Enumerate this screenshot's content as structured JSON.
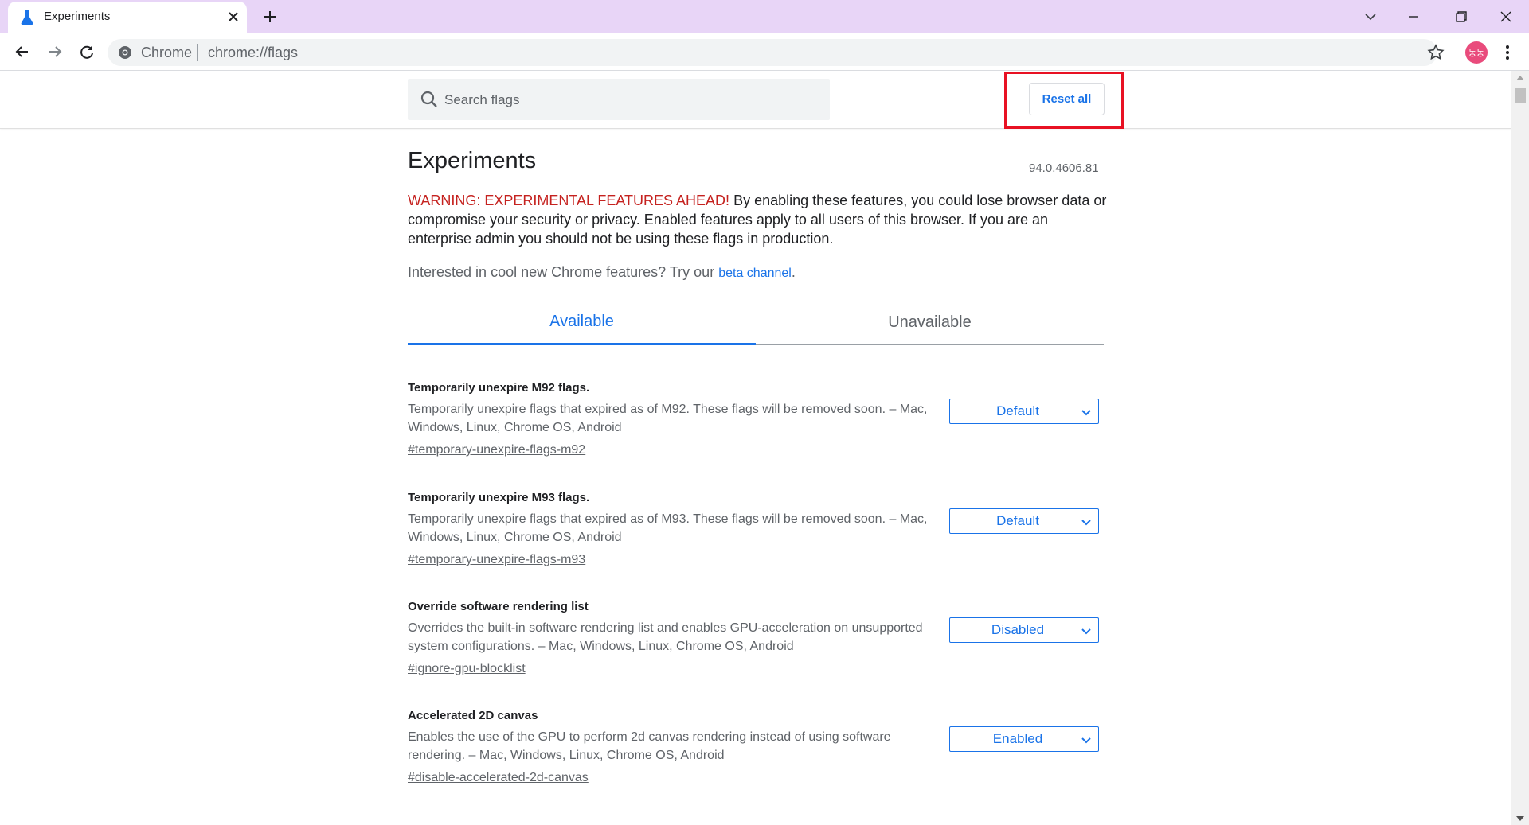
{
  "tab": {
    "title": "Experiments"
  },
  "toolbar": {
    "site_label": "Chrome",
    "url": "chrome://flags"
  },
  "profile": {
    "initials": "동동",
    "color": "#e94b7c"
  },
  "header": {
    "search_placeholder": "Search flags",
    "reset_label": "Reset all"
  },
  "page": {
    "title": "Experiments",
    "version": "94.0.4606.81",
    "warning_prefix": "WARNING: EXPERIMENTAL FEATURES AHEAD!",
    "warning_text": " By enabling these features, you could lose browser data or compromise your security or privacy. Enabled features apply to all users of this browser. If you are an enterprise admin you should not be using these flags in production.",
    "intro_text": "Interested in cool new Chrome features? Try our ",
    "intro_link": "beta channel",
    "intro_suffix": "."
  },
  "tabs": {
    "available": "Available",
    "unavailable": "Unavailable"
  },
  "flags": [
    {
      "title": "Temporarily unexpire M92 flags.",
      "desc": "Temporarily unexpire flags that expired as of M92. These flags will be removed soon. – Mac, Windows, Linux, Chrome OS, Android",
      "link": "#temporary-unexpire-flags-m92",
      "value": "Default"
    },
    {
      "title": "Temporarily unexpire M93 flags.",
      "desc": "Temporarily unexpire flags that expired as of M93. These flags will be removed soon. – Mac, Windows, Linux, Chrome OS, Android",
      "link": "#temporary-unexpire-flags-m93",
      "value": "Default"
    },
    {
      "title": "Override software rendering list",
      "desc": "Overrides the built-in software rendering list and enables GPU-acceleration on unsupported system configurations. – Mac, Windows, Linux, Chrome OS, Android",
      "link": "#ignore-gpu-blocklist",
      "value": "Disabled"
    },
    {
      "title": "Accelerated 2D canvas",
      "desc": "Enables the use of the GPU to perform 2d canvas rendering instead of using software rendering. – Mac, Windows, Linux, Chrome OS, Android",
      "link": "#disable-accelerated-2d-canvas",
      "value": "Enabled"
    }
  ],
  "colors": {
    "accent": "#1a73e8",
    "warning": "#c5221f",
    "highlight": "#e81123",
    "titlebar": "#e8d5f7"
  }
}
